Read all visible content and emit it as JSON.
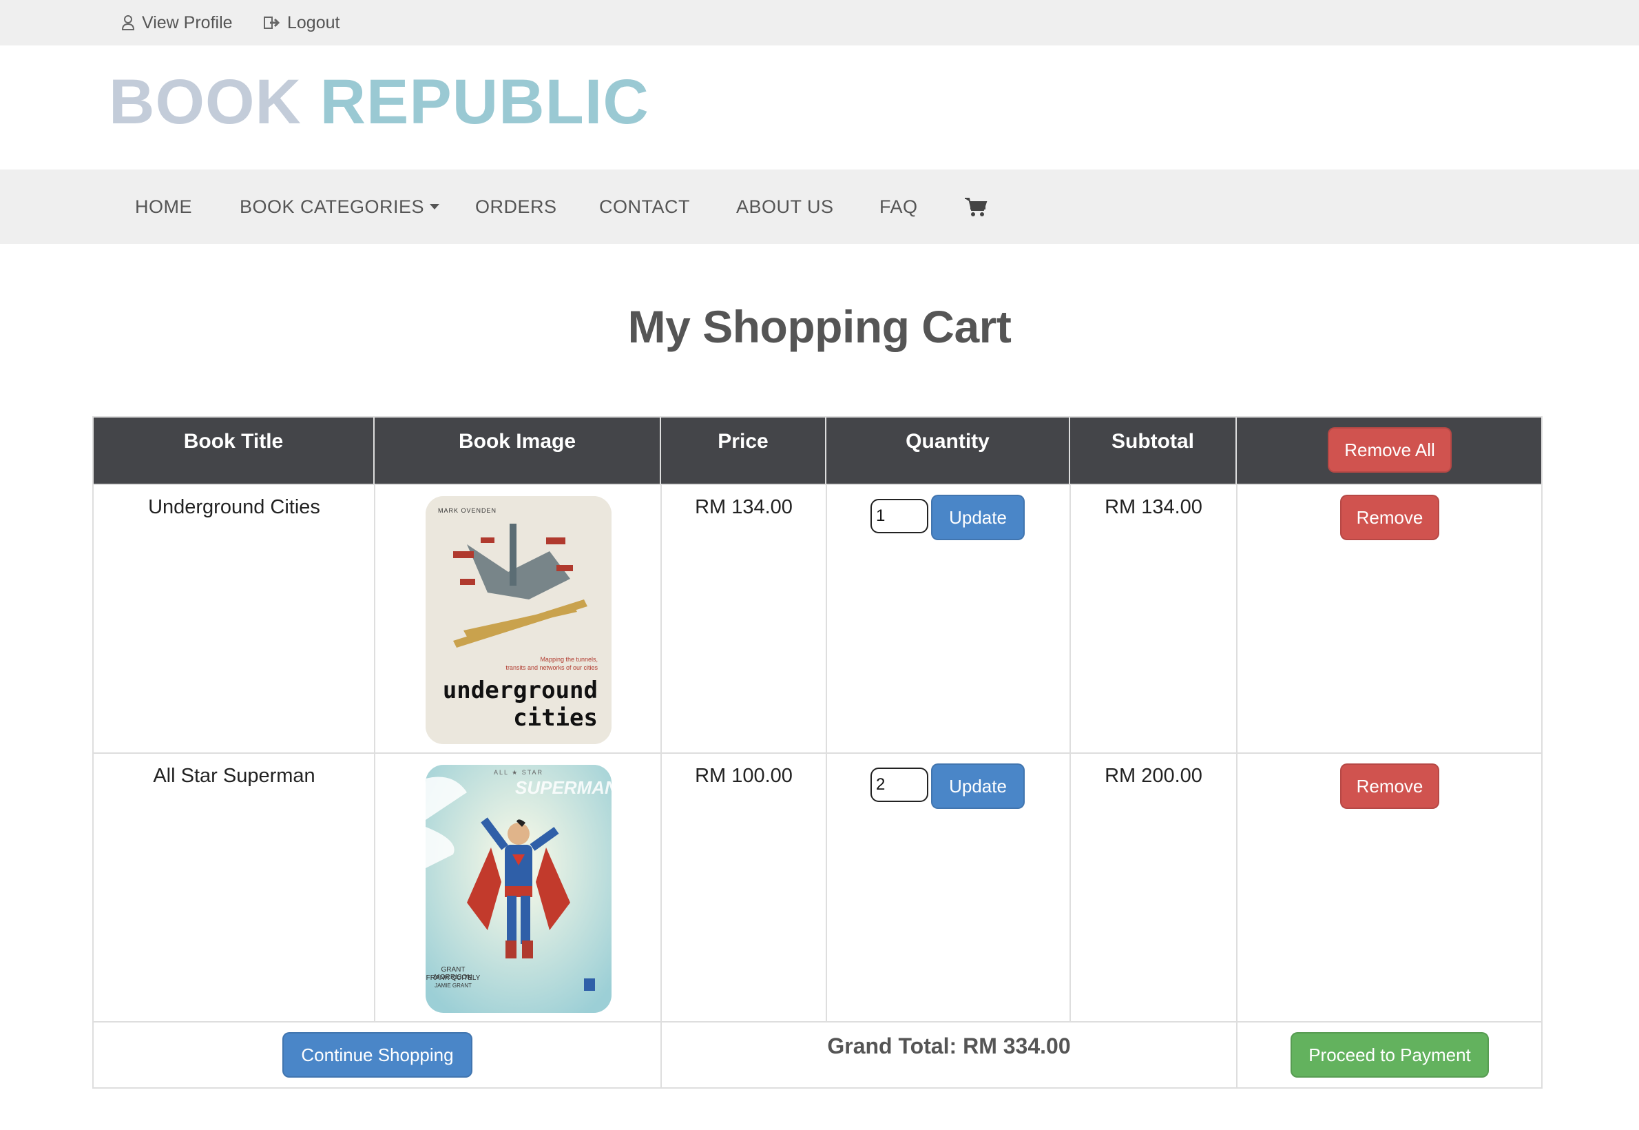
{
  "topbar": {
    "view_profile": "View Profile",
    "logout": "Logout"
  },
  "brand": {
    "word1": "BOOK",
    "word2": "REPUBLIC"
  },
  "nav": {
    "items": [
      "HOME",
      "BOOK CATEGORIES",
      "ORDERS",
      "CONTACT",
      "ABOUT US",
      "FAQ"
    ],
    "cart_icon": "shopping-cart-icon"
  },
  "page_title": "My Shopping Cart",
  "table": {
    "headers": [
      "Book Title",
      "Book Image",
      "Price",
      "Quantity",
      "Subtotal"
    ],
    "remove_all": "Remove All",
    "rows": [
      {
        "title": "Underground Cities",
        "cover": {
          "author": "MARK OVENDEN",
          "tagline1": "Mapping the tunnels,",
          "tagline2": "transits and networks of our cities",
          "title1": "underground",
          "title2": "cities"
        },
        "price": "RM 134.00",
        "quantity": "1",
        "update": "Update",
        "subtotal": "RM 134.00",
        "remove": "Remove"
      },
      {
        "title": "All Star Superman",
        "cover": {
          "top": "ALL ★ STAR",
          "logo": "SUPERMAN",
          "credit1": "GRANT MORRISON",
          "credit2": "FRANK QUITELY",
          "credit3": "JAMIE GRANT"
        },
        "price": "RM 100.00",
        "quantity": "2",
        "update": "Update",
        "subtotal": "RM 200.00",
        "remove": "Remove"
      }
    ],
    "continue_shopping": "Continue Shopping",
    "grand_total": "Grand Total: RM 334.00",
    "proceed": "Proceed to Payment"
  },
  "colors": {
    "brand_word1": "#c3ccd9",
    "brand_word2": "#9ac9d3",
    "header_bg": "#444549",
    "danger": "#d0534f",
    "primary": "#4a86c8",
    "success": "#63b25e"
  }
}
